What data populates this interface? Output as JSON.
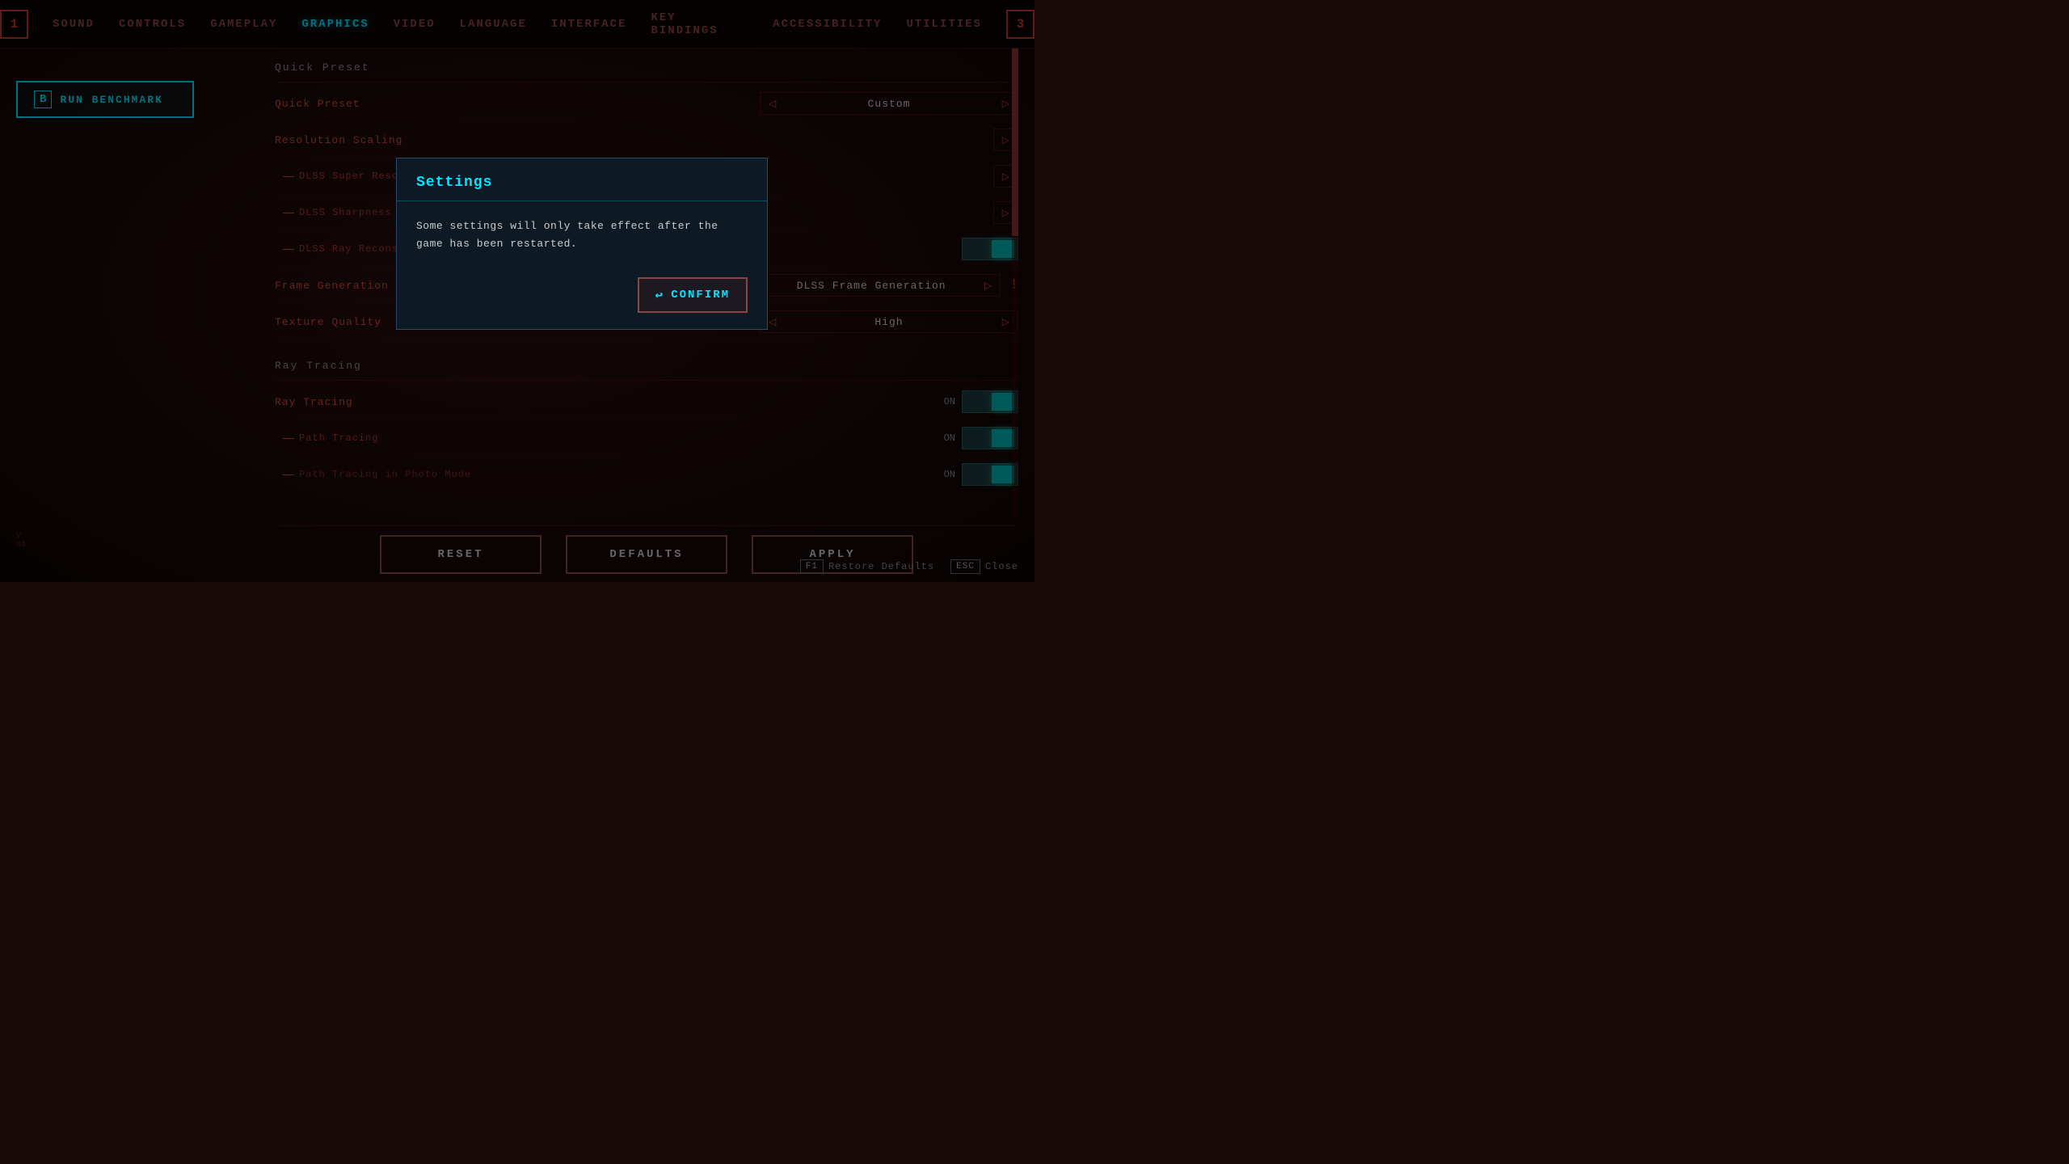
{
  "nav": {
    "left_btn": "1",
    "right_btn": "3",
    "items": [
      {
        "label": "SOUND",
        "active": false
      },
      {
        "label": "CONTROLS",
        "active": false
      },
      {
        "label": "GAMEPLAY",
        "active": false
      },
      {
        "label": "GRAPHICS",
        "active": true
      },
      {
        "label": "VIDEO",
        "active": false
      },
      {
        "label": "LANGUAGE",
        "active": false
      },
      {
        "label": "INTERFACE",
        "active": false
      },
      {
        "label": "KEY BINDINGS",
        "active": false
      },
      {
        "label": "ACCESSIBILITY",
        "active": false
      },
      {
        "label": "UTILITIES",
        "active": false
      }
    ]
  },
  "sidebar": {
    "benchmark_key": "B",
    "benchmark_label": "RUN BENCHMARK"
  },
  "quick_preset": {
    "section_label": "Quick Preset",
    "rows": [
      {
        "label": "Quick Preset",
        "value": "Custom",
        "type": "selector"
      }
    ]
  },
  "resolution_section": {
    "label": "Resolution Scaling",
    "sub_rows": [
      {
        "label": "DLSS Super Resolution",
        "type": "selector",
        "value": ""
      },
      {
        "label": "DLSS Sharpness",
        "type": "selector",
        "value": ""
      },
      {
        "label": "DLSS Ray Reconstruction",
        "type": "toggle",
        "value": "ON"
      }
    ]
  },
  "frame_generation": {
    "label": "Frame Generation",
    "value": "DLSS Frame Generation",
    "type": "selector",
    "warning": true
  },
  "texture_quality": {
    "label": "Texture Quality",
    "value": "High",
    "type": "selector"
  },
  "ray_tracing": {
    "section_label": "Ray Tracing",
    "rows": [
      {
        "label": "Ray Tracing",
        "value": "ON",
        "type": "toggle"
      },
      {
        "label": "Path Tracing",
        "value": "ON",
        "type": "toggle",
        "sub": true
      },
      {
        "label": "Path Tracing in Photo Mode",
        "value": "ON",
        "type": "toggle",
        "sub": true
      }
    ]
  },
  "buttons": {
    "reset": "RESET",
    "defaults": "DEFAULTS",
    "apply": "APPLY"
  },
  "footer": {
    "restore_key": "F1",
    "restore_label": "Restore Defaults",
    "close_key": "ESC",
    "close_label": "Close"
  },
  "version": {
    "line1": "V",
    "line2": "85"
  },
  "modal": {
    "title": "Settings",
    "body": "Some settings will only take effect after the game has been restarted.",
    "confirm_icon": "↩",
    "confirm_label": "CONFIRM"
  }
}
